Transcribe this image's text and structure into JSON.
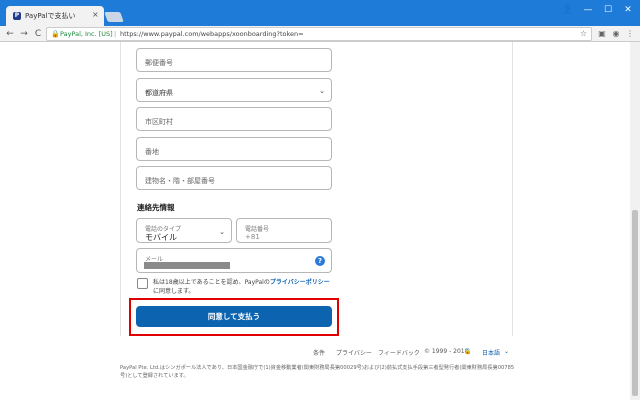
{
  "browser": {
    "tab_title": "PayPalで支払い",
    "tab_close": "×",
    "favicon": "P",
    "window_controls": {
      "user": "👤",
      "minimize": "—",
      "maximize": "☐",
      "close": "✕"
    },
    "nav": {
      "back": "←",
      "forward": "→",
      "reload": "C"
    },
    "address": {
      "lock": "🔒",
      "org": "PayPal, Inc. [US]",
      "separator": "|",
      "url": "https://www.paypal.com/webapps/xoonboarding?token=",
      "star": "☆"
    },
    "extensions": {
      "ext1": "▣",
      "ext2": "◉",
      "menu": "⋮"
    }
  },
  "form": {
    "postal_code_placeholder": "郵便番号",
    "prefecture_placeholder": "都道府県",
    "city_placeholder": "市区町村",
    "address_placeholder": "番地",
    "building_placeholder": "建物名・階・部屋番号",
    "contact_section_title": "連絡先情報",
    "phone_type_label": "電話のタイプ",
    "phone_type_value": "モバイル",
    "phone_number_label": "電話番号",
    "phone_number_value": "+81",
    "email_label": "メール",
    "help_icon_text": "?",
    "consent_text_before": "私は18歳以上であることを認め、PayPalの",
    "consent_link": "プライバシーポリシー",
    "consent_text_after": "に同意します。",
    "submit_label": "同意して支払う"
  },
  "footer": {
    "terms": "条件",
    "privacy": "プライバシー",
    "feedback": "フィードバック",
    "copyright": "© 1999 - 2018",
    "lock": "🔒",
    "language": "日本語",
    "note": "PayPal Pte. Ltd.はシンガポール法人であり、日本国金融庁で(1)資金移動業者(関東財務局長第00029号)および(2)前払式支払手段第三者型発行者(関東財務局長第00785号)として登録されています。"
  },
  "colors": {
    "primary_button": "#0c63b0",
    "highlight": "#e00000",
    "browser_chrome": "#1f7bd8"
  }
}
